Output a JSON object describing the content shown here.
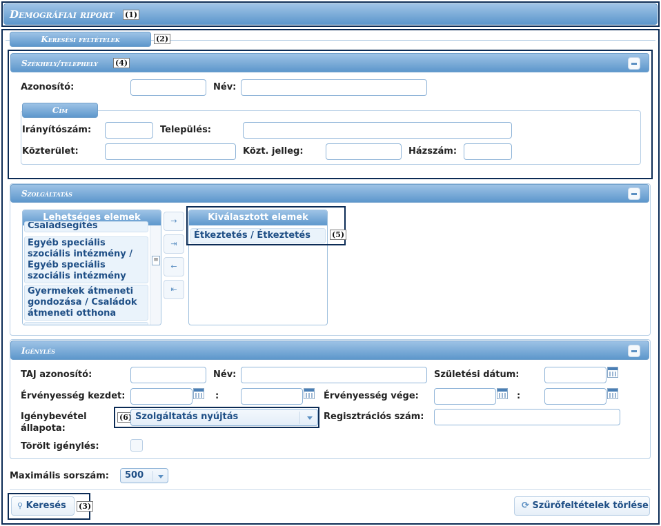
{
  "title_bar": {
    "title": "Demográfiai riport",
    "marker": "(1)"
  },
  "tab": {
    "label": "Keresési feltételek",
    "marker": "(2)"
  },
  "section_site": {
    "title": "Székhely/telephely",
    "marker": "(4)",
    "azonosito_label": "Azonosító:",
    "azonosito_value": "",
    "nev_label": "Név:",
    "nev_value": "",
    "address": {
      "legend": "Cím",
      "iranyitoszam_label": "Irányítószám:",
      "telepules_label": "Település:",
      "kozterulet_label": "Közterület:",
      "kozt_jelleg_label": "Közt. jelleg:",
      "hazszam_label": "Házszám:"
    }
  },
  "section_service": {
    "title": "Szolgáltatás",
    "available_header": "Lehetséges elemek",
    "available_items": [
      "Családsegítés",
      "Egyéb speciális szociális intézmény / Egyéb speciális szociális intézmény",
      "Gyermekek átmeneti gondozása / Családok átmeneti otthona"
    ],
    "selected_header": "Kiválasztott elemek",
    "selected_items": [
      "Étkeztetés / Étkeztetés"
    ],
    "marker": "(5)",
    "move_buttons": [
      "→",
      "⇥",
      "←",
      "⇤"
    ]
  },
  "section_request": {
    "title": "Igénylés",
    "taj_label": "TAJ azonosító:",
    "nev_label": "Név:",
    "szuletesi_label": "Születési dátum:",
    "ervenyesseg_kezdet_label": "Érvényesség kezdet:",
    "ervenyesseg_vege_label": "Érvényesség vége:",
    "range_separator": ":",
    "allapot_label_1": "Igénybevétel",
    "allapot_label_2": "állapota:",
    "allapot_value": "Szolgáltatás nyújtás",
    "marker": "(6)",
    "regisztracios_label": "Regisztrációs szám:",
    "torolt_label": "Törölt igénylés:",
    "torolt_checked": false
  },
  "max_row": {
    "label": "Maximális sorszám:",
    "value": "500"
  },
  "actions": {
    "search_label": "Keresés",
    "search_marker": "(3)",
    "clear_label": "Szűrőfeltételek törlése"
  }
}
